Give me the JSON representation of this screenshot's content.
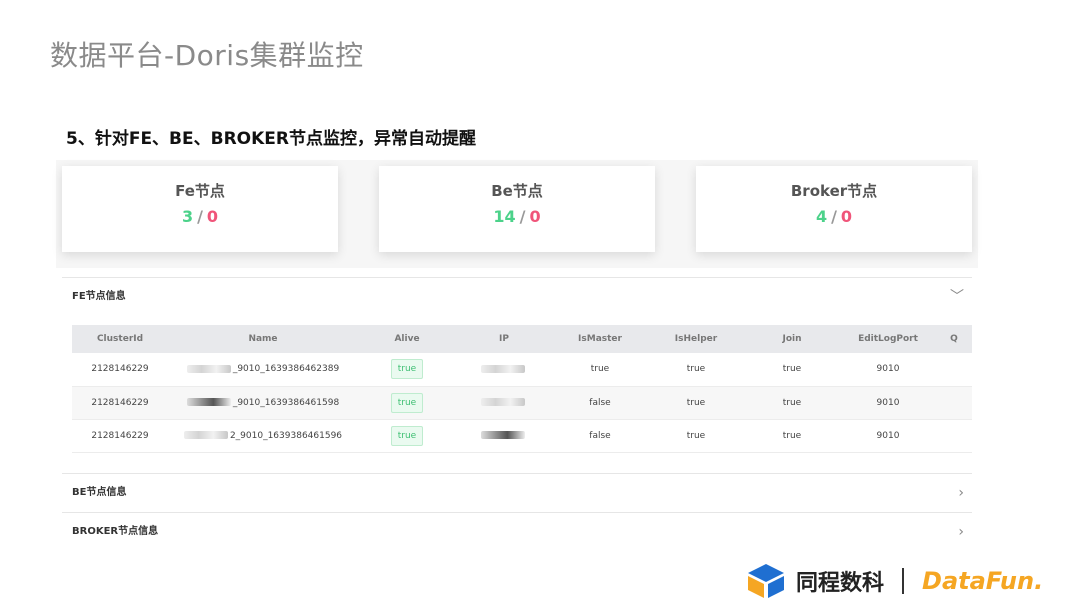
{
  "slide": {
    "title": "数据平台-Doris集群监控",
    "subtitle": "5、针对FE、BE、BROKER节点监控，异常自动提醒"
  },
  "stats": [
    {
      "name": "Fe节点",
      "ok": "3",
      "sep": "/",
      "bad": "0"
    },
    {
      "name": "Be节点",
      "ok": "14",
      "sep": "/",
      "bad": "0"
    },
    {
      "name": "Broker节点",
      "ok": "4",
      "sep": "/",
      "bad": "0"
    }
  ],
  "sections": {
    "fe": {
      "label": "FE节点信息",
      "chevron": "﹀"
    },
    "be": {
      "label": "BE节点信息",
      "chevron": "›"
    },
    "broker": {
      "label": "BROKER节点信息",
      "chevron": "›"
    }
  },
  "fe_table": {
    "columns": [
      "ClusterId",
      "Name",
      "Alive",
      "IP",
      "IsMaster",
      "IsHelper",
      "Join",
      "EditLogPort",
      "Q"
    ],
    "rows": [
      {
        "clusterId": "2128146229",
        "name": "_9010_1639386462389",
        "alive": "true",
        "isMaster": "true",
        "isHelper": "true",
        "join": "true",
        "port": "9010"
      },
      {
        "clusterId": "2128146229",
        "name": "_9010_1639386461598",
        "alive": "true",
        "isMaster": "false",
        "isHelper": "true",
        "join": "true",
        "port": "9010"
      },
      {
        "clusterId": "2128146229",
        "name": "2_9010_1639386461596",
        "alive": "true",
        "isMaster": "false",
        "isHelper": "true",
        "join": "true",
        "port": "9010"
      }
    ]
  },
  "footer": {
    "brand": "同程数科",
    "partner": "DataFun.",
    "colors": {
      "brand_blue": "#1f6fd1",
      "brand_orange": "#f5a623"
    }
  },
  "colors": {
    "ok": "#4cd28a",
    "bad": "#f0557a"
  }
}
